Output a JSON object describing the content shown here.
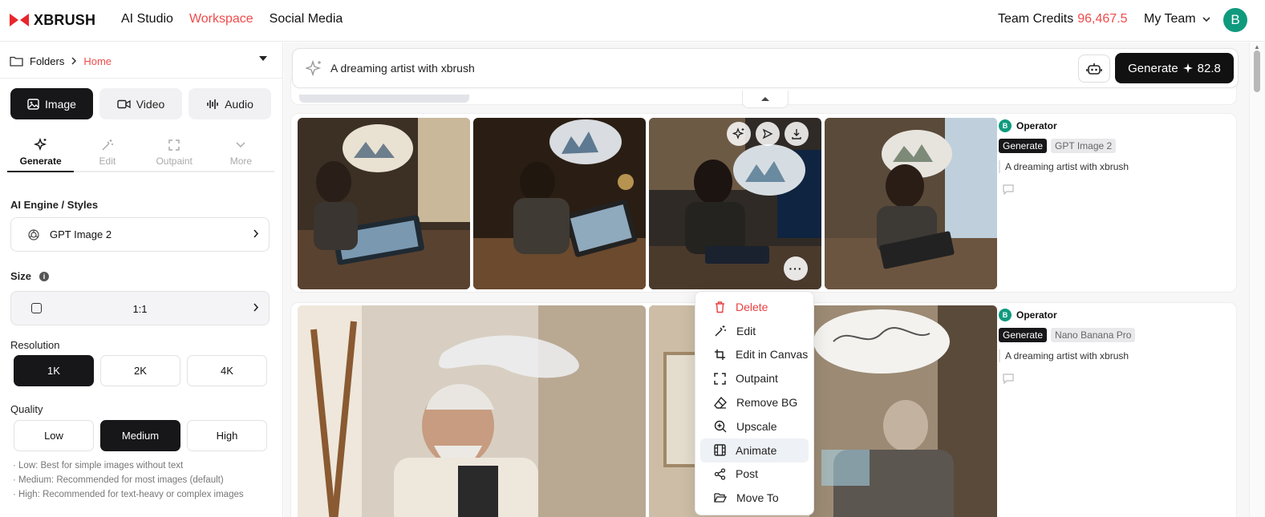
{
  "app": {
    "brand": "XBRUSH",
    "brand_color": "#e8262c",
    "accent": "#ef4b4b"
  },
  "nav": {
    "items": [
      "AI Studio",
      "Workspace",
      "Social Media"
    ],
    "active": "Workspace"
  },
  "header": {
    "credits_label": "Team Credits",
    "credits_value": "96,467.5",
    "team_label": "My Team",
    "avatar_initial": "B"
  },
  "sidebar": {
    "folders_label": "Folders",
    "breadcrumb_current": "Home",
    "type_tabs": [
      "Image",
      "Video",
      "Audio"
    ],
    "mode_tabs": [
      "Generate",
      "Edit",
      "Outpaint",
      "More"
    ],
    "engine_label": "AI Engine / Styles",
    "engine_value": "GPT Image 2",
    "size_label": "Size",
    "size_value": "1:1",
    "resolution_label": "Resolution",
    "resolution_options": [
      "1K",
      "2K",
      "4K"
    ],
    "resolution_selected": "1K",
    "quality_label": "Quality",
    "quality_options": [
      "Low",
      "Medium",
      "High"
    ],
    "quality_selected": "Medium",
    "quality_notes": [
      "· Low: Best for simple images without text",
      "· Medium: Recommended for most images (default)",
      "· High: Recommended for text-heavy or complex images"
    ]
  },
  "prompt": {
    "text": "A dreaming artist with xbrush",
    "generate_label": "Generate",
    "generate_cost": "82.8"
  },
  "generations": [
    {
      "operator": "Operator",
      "avatar": "B",
      "mode_tag": "Generate",
      "model_tag": "GPT Image 2",
      "prompt": "A dreaming artist with xbrush"
    },
    {
      "operator": "Operator",
      "avatar": "B",
      "mode_tag": "Generate",
      "model_tag": "Nano Banana Pro",
      "prompt": "A dreaming artist with xbrush"
    }
  ],
  "context_menu": {
    "items": [
      "Delete",
      "Edit",
      "Edit in Canvas",
      "Outpaint",
      "Remove BG",
      "Upscale",
      "Animate",
      "Post",
      "Move To"
    ],
    "hovered": "Animate"
  }
}
